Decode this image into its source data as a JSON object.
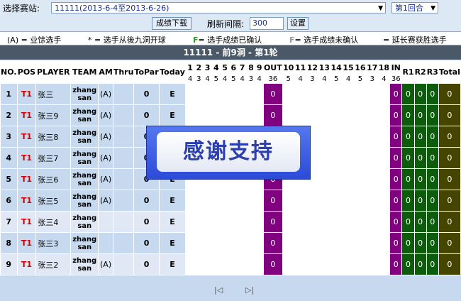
{
  "header": {
    "event_label": "选择赛站:",
    "event_selected": "11111(2013-6-4至2013-6-26)",
    "round_selected": "第1回合",
    "download_button": "成绩下载",
    "refresh_label": "刷新间隔:",
    "refresh_value": "300",
    "settings_button": "设置"
  },
  "legend": {
    "amateur": "(A) = 业馀选手",
    "back_nine": "* = 选手从後九洞开球",
    "confirmed_mark": "F",
    "confirmed_text": "= 选手成绩已确认",
    "unconfirmed_mark": "F",
    "unconfirmed_text": "= 选手成绩未确认",
    "playoff": "= 延长赛获胜选手"
  },
  "table_title": "11111 - 前9洞 - 第1轮",
  "columns": {
    "no": "NO.",
    "pos": "POS",
    "player": "PLAYER",
    "team": "TEAM",
    "am": "AM",
    "thru": "Thru",
    "topar": "ToPar",
    "today": "Today",
    "out": "OUT",
    "in": "IN",
    "r1": "R1",
    "r2": "R2",
    "r3": "R3",
    "total": "Total"
  },
  "holes": [
    "1",
    "2",
    "3",
    "4",
    "5",
    "6",
    "7",
    "8",
    "9",
    "10",
    "11",
    "12",
    "13",
    "14",
    "15",
    "16",
    "17",
    "18"
  ],
  "pars": [
    "4",
    "3",
    "4",
    "5",
    "4",
    "5",
    "4",
    "3",
    "4",
    "5",
    "4",
    "3",
    "4",
    "5",
    "4",
    "5",
    "3",
    "4"
  ],
  "out_par": "36",
  "in_par": "36",
  "players": [
    {
      "no": "1",
      "pos": "T1",
      "name": "张三",
      "team": "zhang san",
      "am": "(A)",
      "thru": "",
      "topar": "0",
      "today": "E",
      "out": "0",
      "in": "0",
      "r1": "0",
      "r2": "0",
      "r3": "0",
      "total": "0"
    },
    {
      "no": "2",
      "pos": "T1",
      "name": "张三9",
      "team": "zhang san",
      "am": "(A)",
      "thru": "",
      "topar": "0",
      "today": "E",
      "out": "0",
      "in": "0",
      "r1": "0",
      "r2": "0",
      "r3": "0",
      "total": "0"
    },
    {
      "no": "3",
      "pos": "T1",
      "name": "张三8",
      "team": "zhang san",
      "am": "(A)",
      "thru": "",
      "topar": "0",
      "today": "E",
      "out": "0",
      "in": "0",
      "r1": "0",
      "r2": "0",
      "r3": "0",
      "total": "0"
    },
    {
      "no": "4",
      "pos": "T1",
      "name": "张三7",
      "team": "zhang san",
      "am": "(A)",
      "thru": "",
      "topar": "0",
      "today": "E",
      "out": "0",
      "in": "0",
      "r1": "0",
      "r2": "0",
      "r3": "0",
      "total": "0"
    },
    {
      "no": "5",
      "pos": "T1",
      "name": "张三6",
      "team": "zhang san",
      "am": "(A)",
      "thru": "",
      "topar": "0",
      "today": "E",
      "out": "0",
      "in": "0",
      "r1": "0",
      "r2": "0",
      "r3": "0",
      "total": "0"
    },
    {
      "no": "6",
      "pos": "T1",
      "name": "张三5",
      "team": "zhang san",
      "am": "(A)",
      "thru": "",
      "topar": "0",
      "today": "E",
      "out": "0",
      "in": "0",
      "r1": "0",
      "r2": "0",
      "r3": "0",
      "total": "0"
    },
    {
      "no": "7",
      "pos": "T1",
      "name": "张三4",
      "team": "zhang san",
      "am": "",
      "thru": "",
      "topar": "0",
      "today": "E",
      "out": "0",
      "in": "0",
      "r1": "0",
      "r2": "0",
      "r3": "0",
      "total": "0"
    },
    {
      "no": "8",
      "pos": "T1",
      "name": "张三3",
      "team": "zhang san",
      "am": "",
      "thru": "",
      "topar": "0",
      "today": "E",
      "out": "0",
      "in": "0",
      "r1": "0",
      "r2": "0",
      "r3": "0",
      "total": "0"
    },
    {
      "no": "9",
      "pos": "T1",
      "name": "张三2",
      "team": "zhang san",
      "am": "(A)",
      "thru": "",
      "topar": "0",
      "today": "E",
      "out": "0",
      "in": "0",
      "r1": "0",
      "r2": "0",
      "r3": "0",
      "total": "0"
    }
  ],
  "footer": {
    "first_page_icon": "|◁",
    "next_page_icon": "▷|"
  },
  "overlay": {
    "text": "感谢支持"
  }
}
